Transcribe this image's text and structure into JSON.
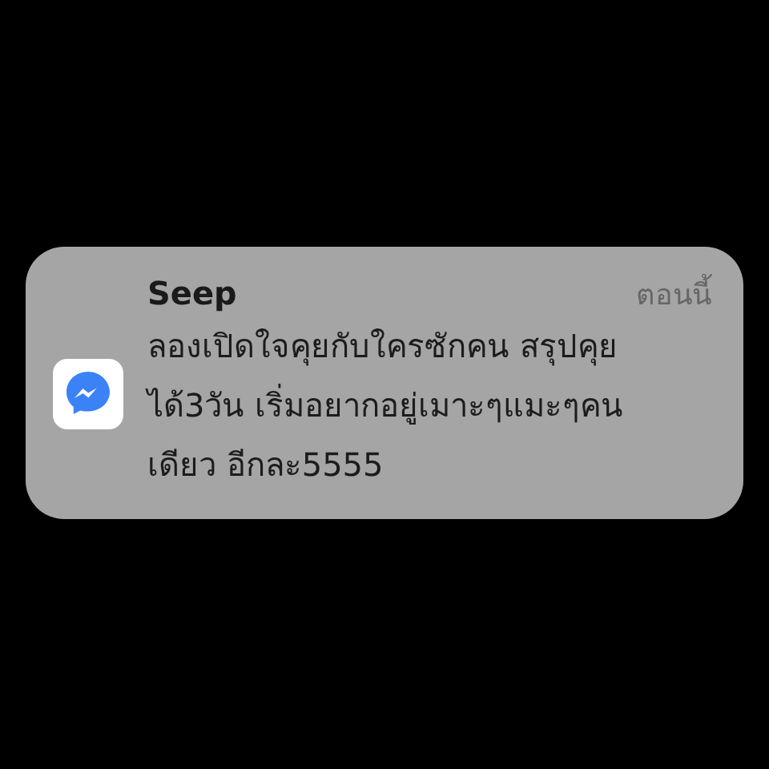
{
  "notification": {
    "sender": "Seep",
    "time": "ตอนนี้",
    "message": "ลองเปิดใจคุยกับใครซักคน สรุปคุย\nได้3วัน เริ่มอยากอยู่เมาะๆแมะๆคน\nเดียว อีกละ5555"
  }
}
